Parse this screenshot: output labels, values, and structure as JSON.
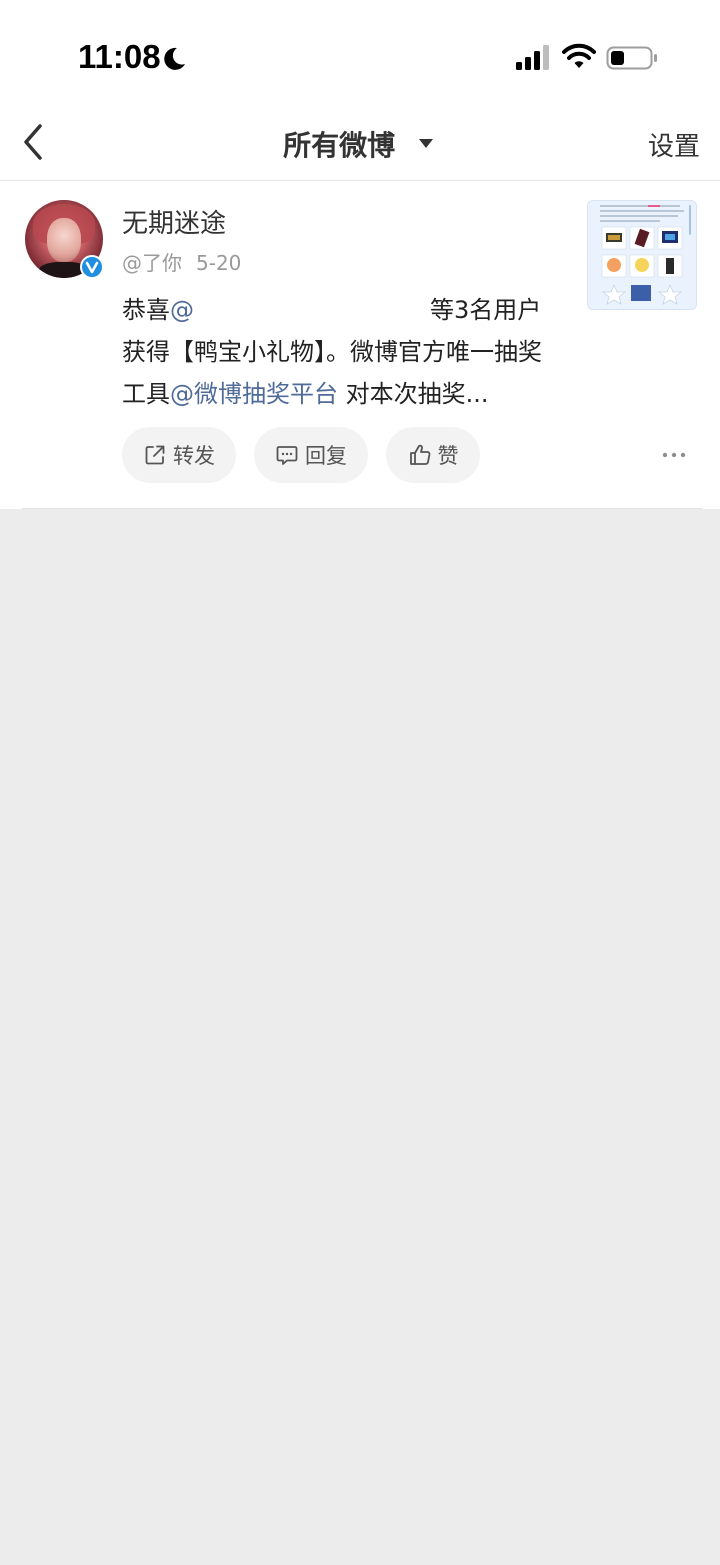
{
  "status_bar": {
    "time": "11:08",
    "icons": [
      "moon-icon",
      "signal-icon",
      "wifi-icon",
      "battery-icon"
    ]
  },
  "nav": {
    "back_icon": "back-chevron-icon",
    "title": "所有微博",
    "title_icon": "caret-down-icon",
    "settings_label": "设置"
  },
  "post": {
    "author": "无期迷途",
    "verified_icon": "verified-badge-icon",
    "handle": "@了你",
    "date": "5-20",
    "text": {
      "p1": "恭喜",
      "mention1": "@",
      "p2": "等3名用户获得【鸭宝小礼物】。微博官方唯一抽奖工具",
      "mention2": "@微博抽奖平台",
      "p3": " 对本次抽奖..."
    },
    "actions": [
      {
        "label": "转发",
        "icon": "share-icon"
      },
      {
        "label": "回复",
        "icon": "comment-icon"
      },
      {
        "label": "赞",
        "icon": "like-icon"
      }
    ],
    "more_icon": "more-icon"
  },
  "colors": {
    "accent_link": "#4f6b9a",
    "verify_blue": "#1e8fe1",
    "page_bg": "#ececec"
  }
}
